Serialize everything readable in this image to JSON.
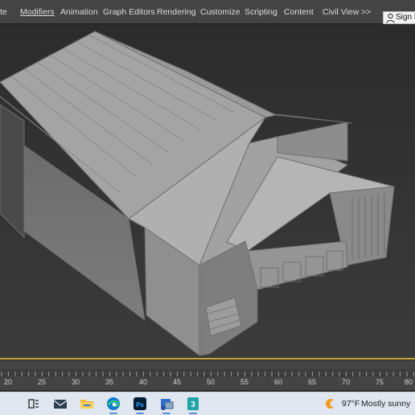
{
  "menubar": {
    "items": [
      "te",
      "Modifiers",
      "Animation",
      "Graph Editors",
      "Rendering",
      "Customize",
      "Scripting",
      "Content",
      "Civil View"
    ],
    "overflow": ">>",
    "sign_in": "Sign In"
  },
  "viewport": {
    "object": "house-model",
    "wireframe_color": "#7a7a7a",
    "surface_color": "#a9a9a9"
  },
  "timeline": {
    "ticks": [
      "20",
      "25",
      "30",
      "35",
      "40",
      "45",
      "50",
      "55",
      "60",
      "65",
      "70",
      "75",
      "80"
    ],
    "indicator_color": "#c8a437"
  },
  "taskbar": {
    "apps": [
      "task-view",
      "mail",
      "file-explorer",
      "edge",
      "photoshop",
      "remote-desktop",
      "3ds-max"
    ],
    "weather": {
      "temperature": "97°F",
      "condition": "Mostly sunny"
    }
  }
}
